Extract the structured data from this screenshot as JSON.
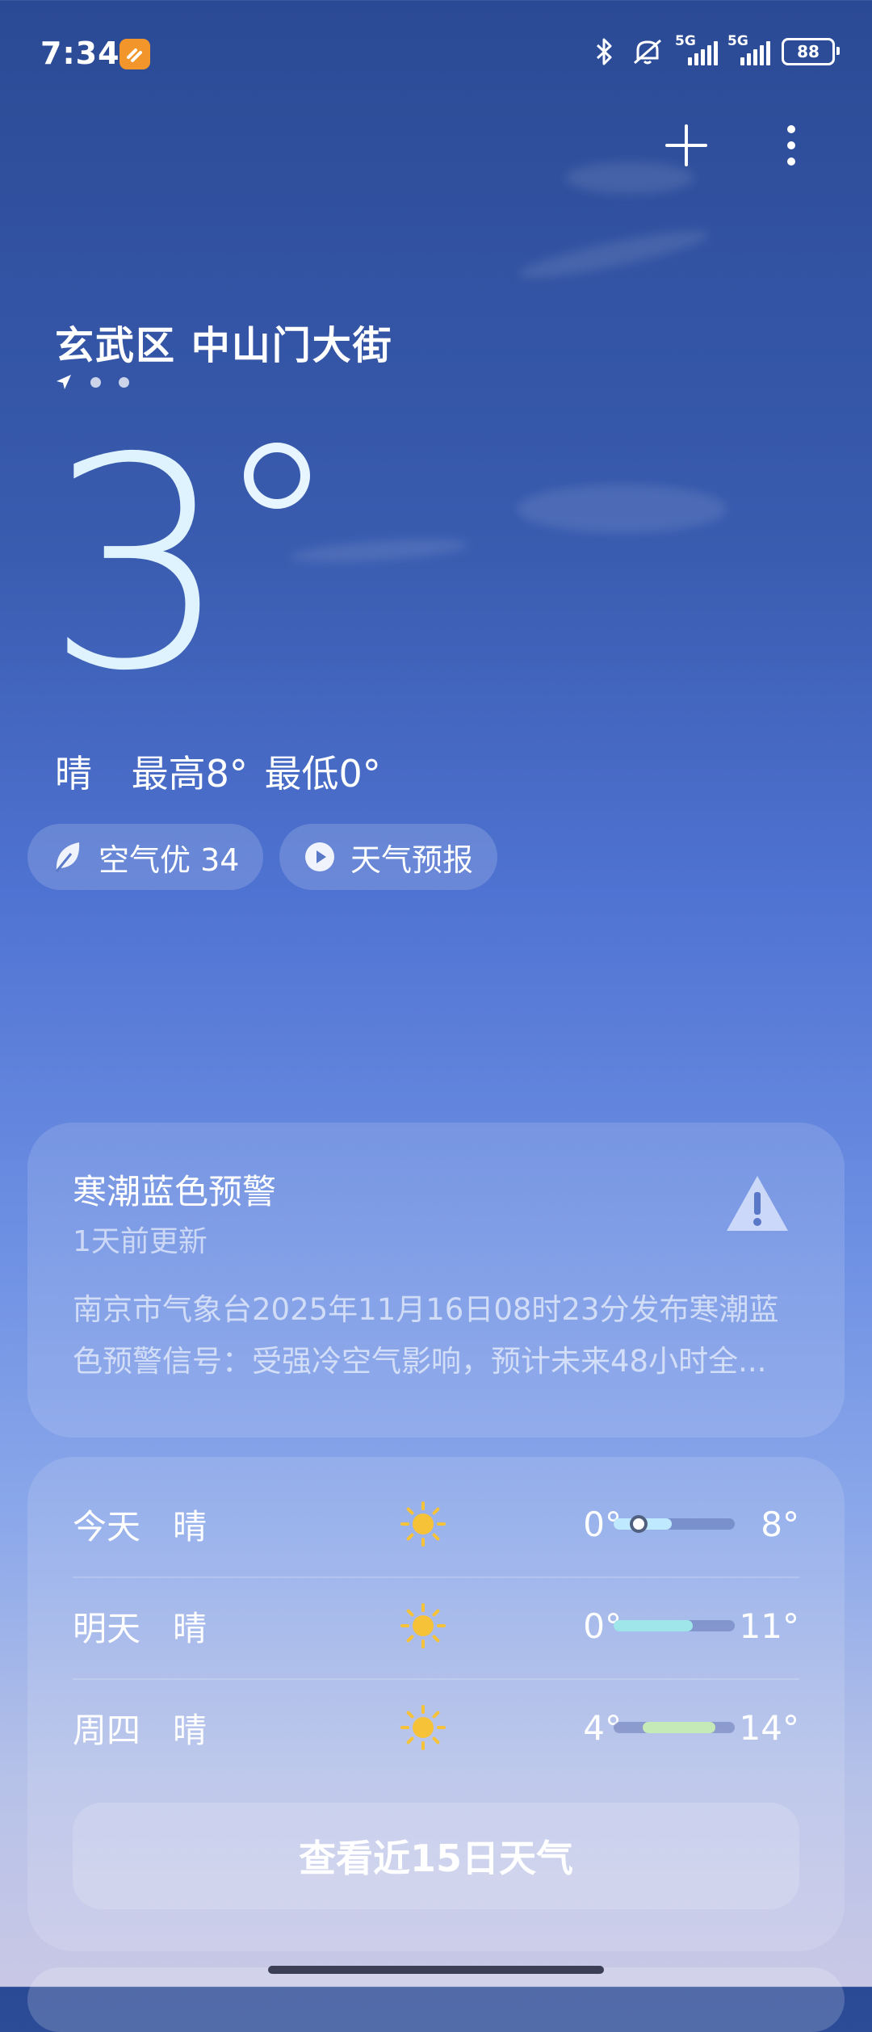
{
  "status_bar": {
    "time": "7:34",
    "net1": "5G",
    "net2": "5G",
    "battery": "88",
    "icons": [
      "app-notification-icon",
      "bluetooth-icon",
      "mute-icon",
      "signal-icon",
      "battery-icon"
    ]
  },
  "actions": {
    "add_icon": "plus-icon",
    "menu_icon": "more-vertical-icon"
  },
  "location": {
    "name": "玄武区 中山门大街"
  },
  "current": {
    "temp": "3",
    "condition": "晴",
    "high_low": "最高8° 最低0°"
  },
  "pills": {
    "air": "空气优 34",
    "forecast_video": "天气预报"
  },
  "alert": {
    "title": "寒潮蓝色预警",
    "updated": "1天前更新",
    "body_line1": "南京市气象台2025年11月16日08时23分发布寒潮蓝",
    "body_line2": "色预警信号：受强冷空气影响，预计未来48小时全..."
  },
  "forecast": {
    "days": [
      {
        "day": "今天",
        "cond": "晴",
        "low": "0°",
        "high": "8°"
      },
      {
        "day": "明天",
        "cond": "晴",
        "low": "0°",
        "high": "11°"
      },
      {
        "day": "周四",
        "cond": "晴",
        "low": "4°",
        "high": "14°"
      }
    ],
    "cta": "查看近15日天气"
  },
  "colors": {
    "sun": "#f6c238",
    "today_fill": "#bfe9ff",
    "tomorrow_fill": "#9fe6ea",
    "thu_fill": "#c6e9b8"
  }
}
